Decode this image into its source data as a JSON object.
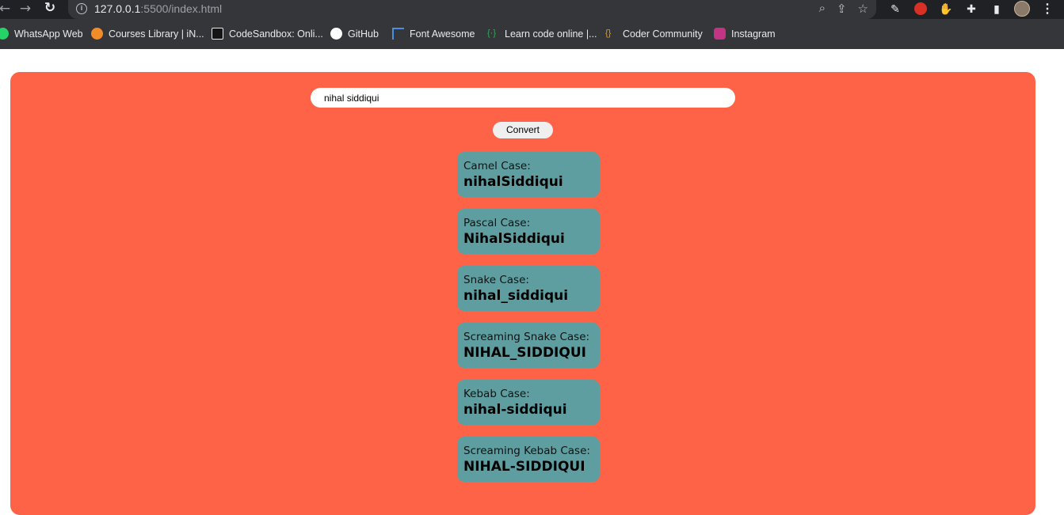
{
  "browser": {
    "url_host": "127.0.0.1",
    "url_rest": ":5500/index.html",
    "bookmarks": [
      {
        "label": "WhatsApp Web",
        "icon": "whatsapp-icon",
        "color": "#25d366"
      },
      {
        "label": "Courses Library | iN...",
        "icon": "courses-icon",
        "color": "#f28b2a"
      },
      {
        "label": "CodeSandbox: Onli...",
        "icon": "codesandbox-icon",
        "color": "#151515"
      },
      {
        "label": "GitHub",
        "icon": "github-icon",
        "color": "#ffffff"
      },
      {
        "label": "Font Awesome",
        "icon": "flag-icon",
        "color": "#4a90e2"
      },
      {
        "label": "Learn code online |...",
        "icon": "code-icon",
        "color": "#34a853"
      },
      {
        "label": "Coder Community",
        "icon": "braces-icon",
        "color": "#f29900"
      },
      {
        "label": "Instagram",
        "icon": "instagram-icon",
        "color": "#c13584"
      }
    ]
  },
  "app": {
    "input_value": "nihal siddiqui",
    "convert_label": "Convert",
    "accent_color": "#ff6347",
    "result_color": "#5f9ea0",
    "results": [
      {
        "label": "Camel Case:",
        "value": "nihalSiddiqui"
      },
      {
        "label": "Pascal Case:",
        "value": "NihalSiddiqui"
      },
      {
        "label": "Snake Case:",
        "value": "nihal_siddiqui"
      },
      {
        "label": "Screaming Snake Case:",
        "value": "NIHAL_SIDDIQUI"
      },
      {
        "label": "Kebab Case:",
        "value": "nihal-siddiqui"
      },
      {
        "label": "Screaming Kebab Case:",
        "value": "NIHAL-SIDDIQUI"
      }
    ]
  }
}
